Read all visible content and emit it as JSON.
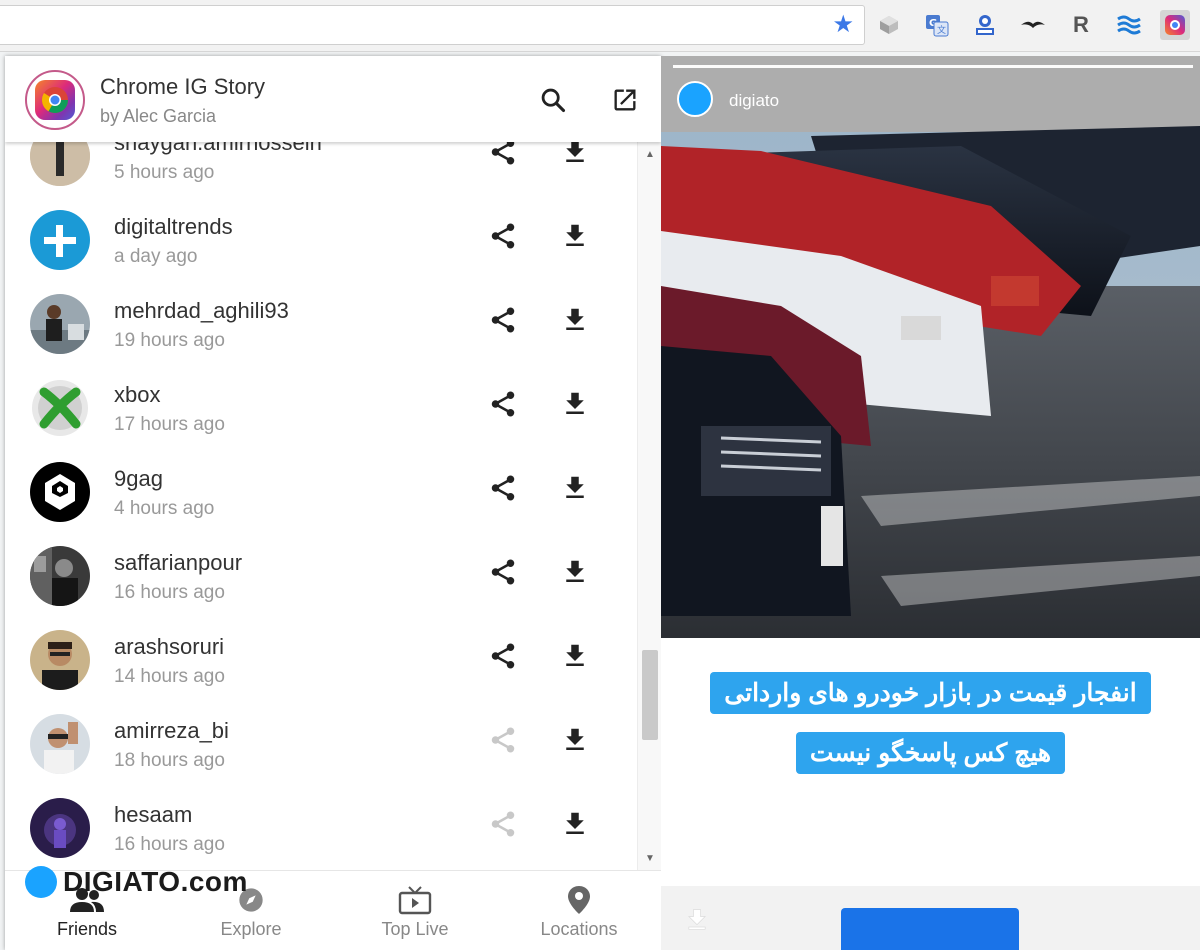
{
  "browser": {
    "extensions": [
      {
        "icon": "cube-icon"
      },
      {
        "icon": "translate-icon"
      },
      {
        "icon": "badge-icon"
      },
      {
        "icon": "bird-icon"
      },
      {
        "icon": "r-letter-icon",
        "label": "R"
      },
      {
        "icon": "waves-icon"
      },
      {
        "icon": "instagram-ext-icon"
      }
    ],
    "star_icon": "bookmark-star-icon"
  },
  "popup": {
    "title": "Chrome IG Story",
    "subtitle": "by Alec Garcia",
    "stories": [
      {
        "username": "shaygan.amirhossein",
        "time": "5 hours ago",
        "share_enabled": true
      },
      {
        "username": "digitaltrends",
        "time": "a day ago",
        "share_enabled": true
      },
      {
        "username": "mehrdad_aghili93",
        "time": "19 hours ago",
        "share_enabled": true
      },
      {
        "username": "xbox",
        "time": "17 hours ago",
        "share_enabled": true
      },
      {
        "username": "9gag",
        "time": "4 hours ago",
        "share_enabled": true
      },
      {
        "username": "saffarianpour",
        "time": "16 hours ago",
        "share_enabled": true
      },
      {
        "username": "arashsoruri",
        "time": "14 hours ago",
        "share_enabled": true
      },
      {
        "username": "amirreza_bi",
        "time": "18 hours ago",
        "share_enabled": false
      },
      {
        "username": "hesaam",
        "time": "16 hours ago",
        "share_enabled": false
      }
    ],
    "nav": [
      {
        "label": "Friends",
        "icon": "people-icon",
        "active": true
      },
      {
        "label": "Explore",
        "icon": "compass-icon",
        "active": false
      },
      {
        "label": "Top Live",
        "icon": "tv-icon",
        "active": false
      },
      {
        "label": "Locations",
        "icon": "location-pin-icon",
        "active": false
      }
    ],
    "watermark": "DIGIATO.com"
  },
  "story": {
    "username": "digiato",
    "caption_line1": "انفجار قیمت در بازار خودرو های وارداتی",
    "caption_line2": "هیچ کس پاسخگو نیست"
  },
  "colors": {
    "accent_blue": "#1a73e8",
    "caption_blue": "#2ea4ee",
    "digiato_blue": "#1aa3ff"
  }
}
